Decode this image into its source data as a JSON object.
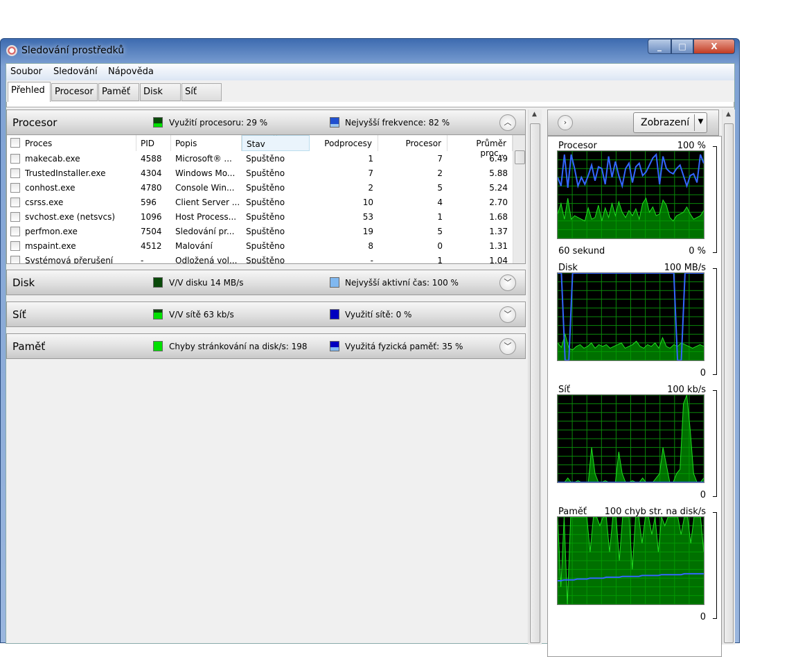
{
  "window": {
    "title": "Sledování prostředků",
    "min": "_",
    "max": "□",
    "close": "X"
  },
  "menu": [
    "Soubor",
    "Sledování",
    "Nápověda"
  ],
  "tabs": [
    "Přehled",
    "Procesor",
    "Paměť",
    "Disk",
    "Síť"
  ],
  "sections": {
    "cpu": {
      "title": "Procesor",
      "stat1": "Využití procesoru: 29 %",
      "stat2": "Nejvyšší frekvence: 82 %"
    },
    "disk": {
      "title": "Disk",
      "stat1": "V/V disku 14 MB/s",
      "stat2": "Nejvyšší aktivní čas: 100 %"
    },
    "net": {
      "title": "Síť",
      "stat1": "V/V sítě 63 kb/s",
      "stat2": "Využití sítě: 0 %"
    },
    "mem": {
      "title": "Paměť",
      "stat1": "Chyby stránkování na disk/s: 198",
      "stat2": "Využitá fyzická paměť: 35 %"
    }
  },
  "colors": {
    "green": "#00c800",
    "blue": "#3366ff",
    "lightblue": "#80b8f0",
    "darkblue": "#0000c0"
  },
  "table": {
    "headers": [
      "Proces",
      "PID",
      "Popis",
      "Stav",
      "Podprocesy",
      "Procesor",
      "Průměr proc..."
    ],
    "rows": [
      [
        "makecab.exe",
        "4588",
        "Microsoft® ...",
        "Spuštěno",
        "1",
        "7",
        "6.49"
      ],
      [
        "TrustedInstaller.exe",
        "4304",
        "Windows Mo...",
        "Spuštěno",
        "7",
        "2",
        "5.88"
      ],
      [
        "conhost.exe",
        "4780",
        "Console Win...",
        "Spuštěno",
        "2",
        "5",
        "5.24"
      ],
      [
        "csrss.exe",
        "596",
        "Client Server ...",
        "Spuštěno",
        "10",
        "4",
        "2.70"
      ],
      [
        "svchost.exe (netsvcs)",
        "1096",
        "Host Process...",
        "Spuštěno",
        "53",
        "1",
        "1.68"
      ],
      [
        "perfmon.exe",
        "7504",
        "Sledování pr...",
        "Spuštěno",
        "19",
        "5",
        "1.37"
      ],
      [
        "mspaint.exe",
        "4512",
        "Malování",
        "Spuštěno",
        "8",
        "0",
        "1.31"
      ],
      [
        "Systémová přerušení",
        "-",
        "Odložená vol...",
        "Spuštěno",
        "-",
        "1",
        "1.04"
      ]
    ]
  },
  "right": {
    "view_button": "Zobrazení",
    "graphs": [
      {
        "label": "Procesor",
        "max": "100 %",
        "min": "0 %",
        "time": "60 sekund",
        "green": [
          28,
          40,
          22,
          46,
          22,
          26,
          24,
          22,
          20,
          35,
          22,
          24,
          38,
          20,
          35,
          24,
          40,
          26,
          42,
          30,
          24,
          32,
          26,
          34,
          22,
          40,
          46,
          30,
          36,
          26,
          28,
          44,
          38,
          24,
          20,
          26,
          28,
          30,
          36,
          28,
          22,
          24,
          26,
          32
        ],
        "blue": [
          70,
          60,
          96,
          58,
          96,
          80,
          60,
          70,
          62,
          72,
          84,
          66,
          82,
          80,
          62,
          94,
          70,
          88,
          72,
          60,
          80,
          86,
          64,
          82,
          86,
          72,
          76,
          84,
          92,
          96,
          62,
          94,
          80,
          76,
          74,
          80,
          84,
          72,
          60,
          72,
          74,
          64,
          96,
          86
        ]
      },
      {
        "label": "Disk",
        "max": "100 MB/s",
        "min": "0",
        "green": [
          20,
          15,
          30,
          14,
          12,
          16,
          18,
          14,
          16,
          20,
          14,
          18,
          16,
          18,
          14,
          16,
          18,
          20,
          14,
          16,
          18,
          22,
          16,
          14,
          18,
          16,
          20,
          14,
          26,
          16,
          14,
          18,
          16,
          20,
          18,
          16,
          14,
          16,
          18,
          16
        ],
        "blue": [
          100,
          100,
          0,
          0,
          100,
          100,
          100,
          100,
          100,
          100,
          100,
          100,
          100,
          100,
          100,
          100,
          100,
          100,
          100,
          100,
          100,
          100,
          100,
          100,
          100,
          100,
          100,
          100,
          100,
          100,
          100,
          100,
          0,
          0,
          100,
          100,
          100,
          100,
          100,
          100
        ]
      },
      {
        "label": "Síť",
        "max": "100 kb/s",
        "min": "0",
        "green": [
          0,
          0,
          0,
          5,
          0,
          0,
          2,
          0,
          0,
          0,
          40,
          10,
          0,
          0,
          2,
          0,
          0,
          0,
          35,
          10,
          0,
          0,
          2,
          0,
          0,
          5,
          0,
          0,
          0,
          5,
          10,
          40,
          20,
          0,
          0,
          10,
          15,
          90,
          100,
          60,
          10,
          0,
          0,
          5
        ],
        "blue": [
          0,
          0,
          0,
          0,
          0,
          0,
          0,
          0,
          0,
          0,
          0,
          0,
          0,
          0,
          0,
          0,
          0,
          0,
          0,
          0,
          0,
          0,
          0,
          0,
          0,
          0,
          0,
          0,
          0,
          0,
          0,
          0,
          0,
          0,
          0,
          0,
          0,
          0,
          0,
          0,
          0,
          0,
          0,
          0
        ]
      },
      {
        "label": "Paměť",
        "max": "100 chyb str. na disk/s",
        "min": "0",
        "green": [
          100,
          20,
          100,
          0,
          100,
          100,
          100,
          100,
          100,
          100,
          60,
          100,
          100,
          90,
          100,
          100,
          60,
          100,
          100,
          50,
          100,
          100,
          100,
          40,
          100,
          100,
          70,
          100,
          100,
          80,
          100,
          60,
          100,
          90,
          100,
          100,
          100,
          100,
          80,
          100,
          100,
          70,
          100,
          100,
          100,
          60
        ],
        "blue": [
          27,
          27,
          28,
          28,
          28,
          28,
          29,
          29,
          29,
          29,
          30,
          30,
          30,
          30,
          30,
          31,
          31,
          31,
          31,
          31,
          32,
          32,
          32,
          32,
          32,
          32,
          33,
          33,
          33,
          33,
          33,
          33,
          34,
          34,
          34,
          34,
          34,
          34,
          34,
          35,
          35,
          35,
          35,
          35,
          35,
          35
        ]
      }
    ]
  }
}
